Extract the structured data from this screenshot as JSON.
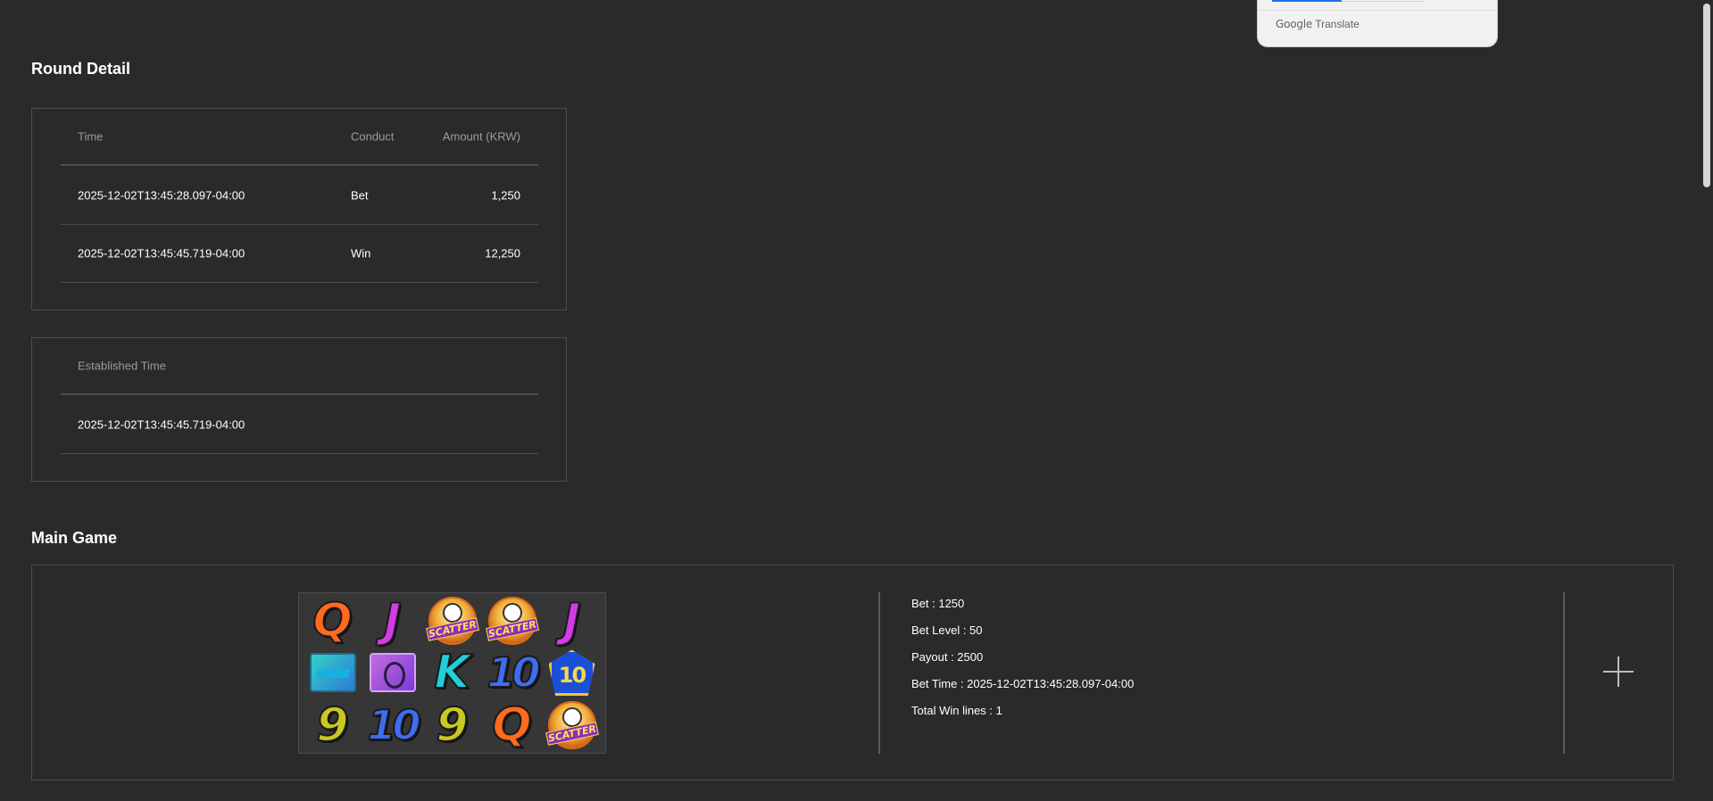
{
  "translate_popup": {
    "brand_google": "Google",
    "brand_translate": "Translate"
  },
  "round_detail": {
    "title": "Round Detail",
    "transactions": {
      "headers": {
        "time": "Time",
        "conduct": "Conduct",
        "amount": "Amount (KRW)"
      },
      "rows": [
        {
          "time": "2025-12-02T13:45:28.097-04:00",
          "conduct": "Bet",
          "amount": "1,250"
        },
        {
          "time": "2025-12-02T13:45:45.719-04:00",
          "conduct": "Win",
          "amount": "12,250"
        }
      ]
    },
    "established": {
      "header": "Established Time",
      "value": "2025-12-02T13:45:45.719-04:00"
    }
  },
  "main_game": {
    "title": "Main Game",
    "reels": [
      {
        "symbol": "Q",
        "color": "#ff6a1f"
      },
      {
        "symbol": "J",
        "color": "#d43ae6"
      },
      {
        "symbol": "scatter",
        "label": "SCATTER"
      },
      {
        "symbol": "scatter",
        "label": "SCATTER"
      },
      {
        "symbol": "J",
        "color": "#d43ae6"
      },
      {
        "symbol": "boot-icon"
      },
      {
        "symbol": "glove-icon"
      },
      {
        "symbol": "K",
        "color": "#20cfd8"
      },
      {
        "symbol": "10",
        "color": "#3f6cf0"
      },
      {
        "symbol": "shield-10-icon",
        "label": "10"
      },
      {
        "symbol": "9",
        "color": "#c8c821"
      },
      {
        "symbol": "10",
        "color": "#3f6cf0"
      },
      {
        "symbol": "9",
        "color": "#c8c821"
      },
      {
        "symbol": "Q",
        "color": "#ff6a1f"
      },
      {
        "symbol": "scatter",
        "label": "SCATTER"
      }
    ],
    "info": {
      "bet": "Bet : 1250",
      "bet_level": "Bet Level : 50",
      "payout": "Payout : 2500",
      "bet_time": "Bet Time : 2025-12-02T13:45:28.097-04:00",
      "total_win_lines": "Total Win lines : 1"
    }
  },
  "colors": {
    "background": "#2a2a2b",
    "border": "#4d4d4f",
    "header_text": "#9b9b9b",
    "accent_blue": "#1a73e8"
  }
}
